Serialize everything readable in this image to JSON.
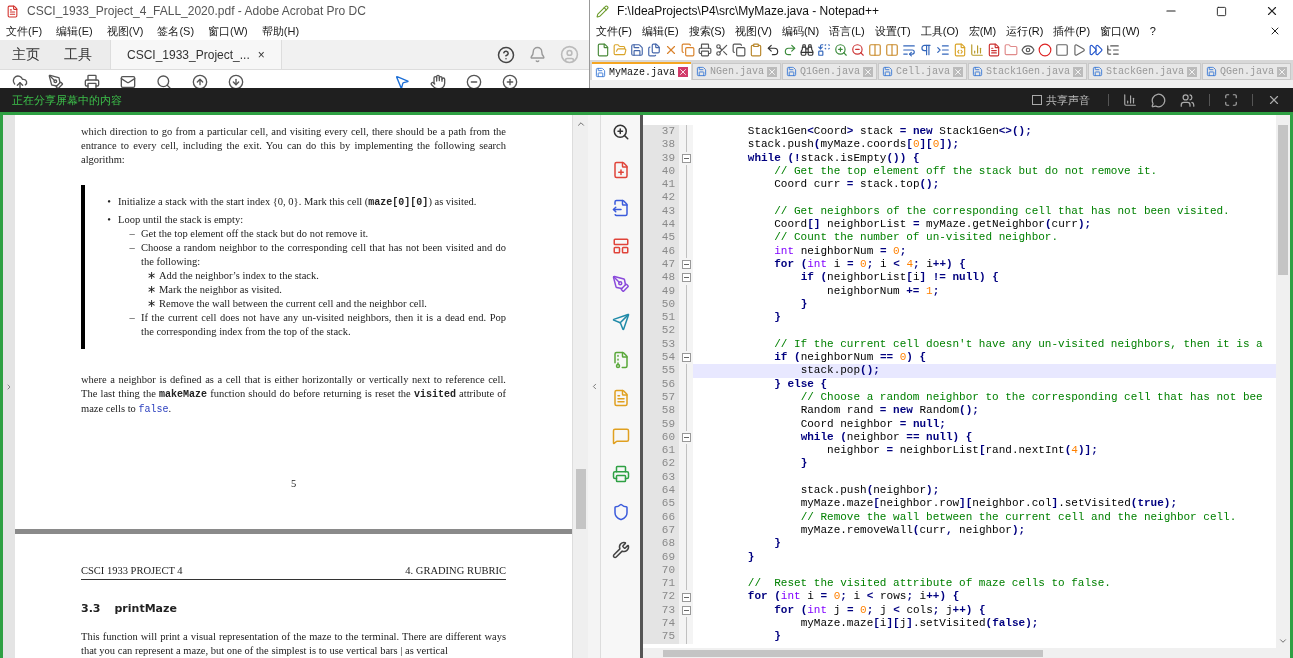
{
  "acrobat": {
    "title": "CSCI_1933_Project_4_FALL_2020.pdf - Adobe Acrobat Pro DC",
    "menu": [
      "文件(F)",
      "编辑(E)",
      "视图(V)",
      "签名(S)",
      "窗口(W)",
      "帮助(H)"
    ],
    "tabs": [
      {
        "label": "主页",
        "selected": false
      },
      {
        "label": "工具",
        "selected": false
      },
      {
        "label": "CSCI_1933_Project_...",
        "selected": true,
        "close": "×"
      }
    ],
    "page": {
      "paragraph": "which direction to go from a particular cell, and visiting every cell, there should be a path from the entrance to every cell, including the exit. You can do this by implementing the following search algorithm:",
      "list": [
        {
          "marker": "•",
          "segments": [
            {
              "kind": "text",
              "text": "Initialize a stack with the start index {0, 0}. Mark this cell ("
            },
            {
              "kind": "code",
              "text": "maze[0][0]"
            },
            {
              "kind": "text",
              "text": ") as visited."
            }
          ]
        },
        {
          "marker": "•",
          "segments": [
            {
              "kind": "text",
              "text": "Loop until the stack is empty:"
            }
          ],
          "children": [
            {
              "marker": "–",
              "segments": [
                {
                  "kind": "text",
                  "text": "Get the top element off the stack but do not remove it."
                }
              ]
            },
            {
              "marker": "–",
              "segments": [
                {
                  "kind": "text",
                  "text": "Choose a random neighbor to the corresponding cell that has not been visited and do the following:"
                }
              ],
              "children": [
                {
                  "marker": "∗",
                  "segments": [
                    {
                      "kind": "text",
                      "text": "Add the neighbor’s index to the stack."
                    }
                  ]
                },
                {
                  "marker": "∗",
                  "segments": [
                    {
                      "kind": "text",
                      "text": "Mark the neighbor as visited."
                    }
                  ]
                },
                {
                  "marker": "∗",
                  "segments": [
                    {
                      "kind": "text",
                      "text": "Remove the wall between the current cell and the neighbor cell."
                    }
                  ]
                }
              ]
            },
            {
              "marker": "–",
              "segments": [
                {
                  "kind": "text",
                  "text": "If the current cell does not have any un-visited neighbors, then it is a dead end. Pop the corresponding index from the top of the stack."
                }
              ]
            }
          ]
        }
      ],
      "closing": [
        {
          "kind": "text",
          "text": "where a neighbor is defined as a cell that is either horizontally or vertically next to reference cell. The last thing the "
        },
        {
          "kind": "code",
          "text": "makeMaze"
        },
        {
          "kind": "text",
          "text": " function should do before returning is reset the "
        },
        {
          "kind": "code",
          "text": "visited"
        },
        {
          "kind": "text",
          "text": " attribute of maze cells to "
        },
        {
          "kind": "literal",
          "text": "false"
        },
        {
          "kind": "text",
          "text": "."
        }
      ],
      "page_number": "5"
    },
    "next_page": {
      "header_left": "CSCI 1933 PROJECT 4",
      "header_right": "4. GRADING RUBRIC",
      "section_number": "3.3",
      "section_title": "printMaze",
      "paragraph": "This function will print a visual representation of the maze to the terminal. There are different ways that you can represent a maze, but one of the simplest is to use vertical bars | as vertical"
    }
  },
  "share_bar": {
    "message": "正在分享屏幕中的内容",
    "share_sound": {
      "label": "共享声音",
      "checked": false
    }
  },
  "notepad": {
    "title": "F:\\IdeaProjects\\P4\\src\\MyMaze.java - Notepad++",
    "menu": [
      "文件(F)",
      "编辑(E)",
      "搜索(S)",
      "视图(V)",
      "编码(N)",
      "语言(L)",
      "设置(T)",
      "工具(O)",
      "宏(M)",
      "运行(R)",
      "插件(P)",
      "窗口(W)",
      "?"
    ],
    "tabs": [
      {
        "label": "MyMaze.java",
        "selected": true
      },
      {
        "label": "NGen.java",
        "selected": false
      },
      {
        "label": "Q1Gen.java",
        "selected": false
      },
      {
        "label": "Cell.java",
        "selected": false
      },
      {
        "label": "Stack1Gen.java",
        "selected": false
      },
      {
        "label": "StackGen.java",
        "selected": false
      },
      {
        "label": "QGen.java",
        "selected": false
      }
    ],
    "lines": [
      {
        "number": "37",
        "text": "        Stack1Gen<Coord> stack = new Stack1Gen<>();",
        "current": false
      },
      {
        "number": "38",
        "text": "        stack.push(myMaze.coords[0][0]);",
        "current": false
      },
      {
        "number": "39",
        "text": "        while (!stack.isEmpty()) {",
        "current": false,
        "fold": true
      },
      {
        "number": "40",
        "text": "            // Get the top element off the stack but do not remove it.",
        "current": false
      },
      {
        "number": "41",
        "text": "            Coord curr = stack.top();",
        "current": false
      },
      {
        "number": "42",
        "current": false
      },
      {
        "number": "43",
        "text": "            // Get neighbors of the corresponding cell that has not been visited.",
        "current": false
      },
      {
        "number": "44",
        "text": "            Coord[] neighborList = myMaze.getNeighbor(curr);",
        "current": false
      },
      {
        "number": "45",
        "text": "            // Count the number of un-visited neighbor.",
        "current": false
      },
      {
        "number": "46",
        "text": "            int neighborNum = 0;",
        "current": false
      },
      {
        "number": "47",
        "text": "            for (int i = 0; i < 4; i++) {",
        "current": false,
        "fold": true
      },
      {
        "number": "48",
        "text": "                if (neighborList[i] != null) {",
        "current": false,
        "fold": true
      },
      {
        "number": "49",
        "text": "                    neighborNum += 1;",
        "current": false
      },
      {
        "number": "50",
        "text": "                }",
        "current": false
      },
      {
        "number": "51",
        "text": "            }",
        "current": false
      },
      {
        "number": "52",
        "current": false
      },
      {
        "number": "53",
        "text": "            // If the current cell doesn't have any un-visited neighbors, then it is a",
        "current": false
      },
      {
        "number": "54",
        "text": "            if (neighborNum == 0) {",
        "current": false,
        "fold": true
      },
      {
        "number": "55",
        "text": "                stack.pop();",
        "current": true
      },
      {
        "number": "56",
        "text": "            } else {",
        "current": false
      },
      {
        "number": "57",
        "text": "                // Choose a random neighbor to the corresponding cell that has not bee",
        "current": false
      },
      {
        "number": "58",
        "text": "                Random rand = new Random();",
        "current": false
      },
      {
        "number": "59",
        "text": "                Coord neighbor = null;",
        "current": false
      },
      {
        "number": "60",
        "text": "                while (neighbor == null) {",
        "current": false,
        "fold": true
      },
      {
        "number": "61",
        "text": "                    neighbor = neighborList[rand.nextInt(4)];",
        "current": false
      },
      {
        "number": "62",
        "text": "                }",
        "current": false
      },
      {
        "number": "63",
        "current": false
      },
      {
        "number": "64",
        "text": "                stack.push(neighbor);",
        "current": false
      },
      {
        "number": "65",
        "text": "                myMaze.maze[neighbor.row][neighbor.col].setVisited(true);",
        "current": false
      },
      {
        "number": "66",
        "text": "                // Remove the wall between the current cell and the neighbor cell.",
        "current": false
      },
      {
        "number": "67",
        "text": "                myMaze.removeWall(curr, neighbor);",
        "current": false
      },
      {
        "number": "68",
        "text": "            }",
        "current": false
      },
      {
        "number": "69",
        "text": "        }",
        "current": false
      },
      {
        "number": "70",
        "current": false
      },
      {
        "number": "71",
        "text": "        //  Reset the visited attribute of maze cells to false.",
        "current": false
      },
      {
        "number": "72",
        "text": "        for (int i = 0; i < rows; i++) {",
        "current": false,
        "fold": true
      },
      {
        "number": "73",
        "text": "            for (int j = 0; j < cols; j++) {",
        "current": false,
        "fold": true
      },
      {
        "number": "74",
        "text": "                myMaze.maze[i][j].setVisited(false);",
        "current": false
      },
      {
        "number": "75",
        "text": "            }",
        "current": false
      }
    ]
  }
}
